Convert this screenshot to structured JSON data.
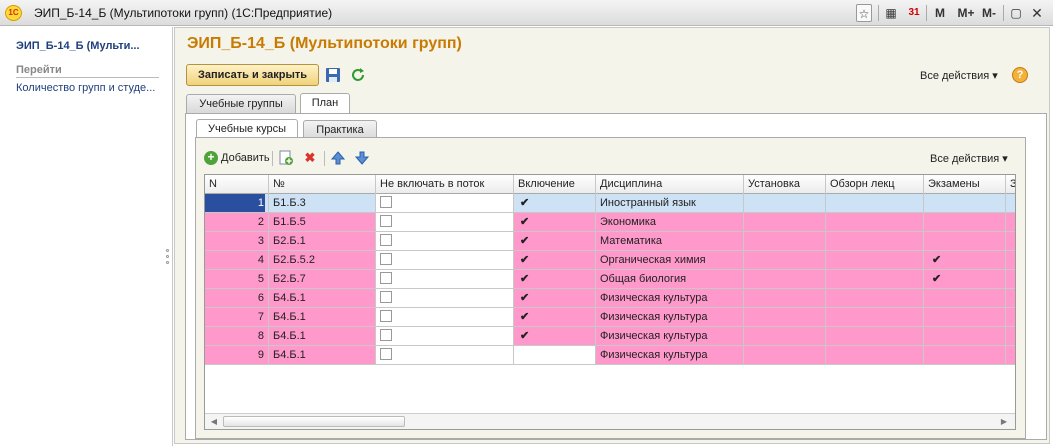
{
  "window": {
    "app_logo": "1С",
    "title": "ЭИП_Б-14_Б (Мультипотоки групп)  (1С:Предприятие)",
    "buttons": [
      "M",
      "M+",
      "M-"
    ],
    "icons": [
      "favorite-icon",
      "calculator-icon",
      "calendar-icon",
      "restore-icon",
      "close-icon"
    ]
  },
  "left_panel": {
    "title": "ЭИП_Б-14_Б (Мульти...",
    "section": "Перейти",
    "link": "Количество групп и студе..."
  },
  "form": {
    "title": "ЭИП_Б-14_Б (Мультипотоки групп)",
    "save_close": "Записать и закрыть",
    "all_actions": "Все действия",
    "help": "?",
    "tabs": [
      "Учебные группы",
      "План"
    ],
    "active_tab": "План"
  },
  "inner": {
    "tabs": [
      "Учебные курсы",
      "Практика"
    ],
    "active_tab": "Учебные курсы",
    "add_label": "Добавить",
    "all_actions": "Все действия"
  },
  "colors": {
    "row_selected": "#cde2f5",
    "row_pink": "#ff99cc",
    "accent": "#c87b00",
    "link": "#1f3f7e"
  },
  "table": {
    "columns": [
      "N",
      "№",
      "Не включать в поток",
      "Включение",
      "Дисциплина",
      "Установка",
      "Обзорн лекц",
      "Экзамены",
      "З"
    ],
    "rows": [
      {
        "n": "1",
        "code": "Б1.Б.3",
        "exclude": false,
        "include": true,
        "discipline": "Иностранный язык",
        "exams": false,
        "state": "selected"
      },
      {
        "n": "2",
        "code": "Б1.Б.5",
        "exclude": false,
        "include": true,
        "discipline": "Экономика",
        "exams": false,
        "state": "pink"
      },
      {
        "n": "3",
        "code": "Б2.Б.1",
        "exclude": false,
        "include": true,
        "discipline": "Математика",
        "exams": false,
        "state": "pink"
      },
      {
        "n": "4",
        "code": "Б2.Б.5.2",
        "exclude": false,
        "include": true,
        "discipline": "Органическая химия",
        "exams": true,
        "state": "pink"
      },
      {
        "n": "5",
        "code": "Б2.Б.7",
        "exclude": false,
        "include": true,
        "discipline": "Общая биология",
        "exams": true,
        "state": "pink"
      },
      {
        "n": "6",
        "code": "Б4.Б.1",
        "exclude": false,
        "include": true,
        "discipline": "Физическая культура",
        "exams": false,
        "state": "pink"
      },
      {
        "n": "7",
        "code": "Б4.Б.1",
        "exclude": false,
        "include": true,
        "discipline": "Физическая культура",
        "exams": false,
        "state": "pink"
      },
      {
        "n": "8",
        "code": "Б4.Б.1",
        "exclude": false,
        "include": true,
        "discipline": "Физическая культура",
        "exams": false,
        "state": "pink"
      },
      {
        "n": "9",
        "code": "Б4.Б.1",
        "exclude": false,
        "include": false,
        "discipline": "Физическая культура",
        "exams": false,
        "state": "pink"
      }
    ]
  }
}
